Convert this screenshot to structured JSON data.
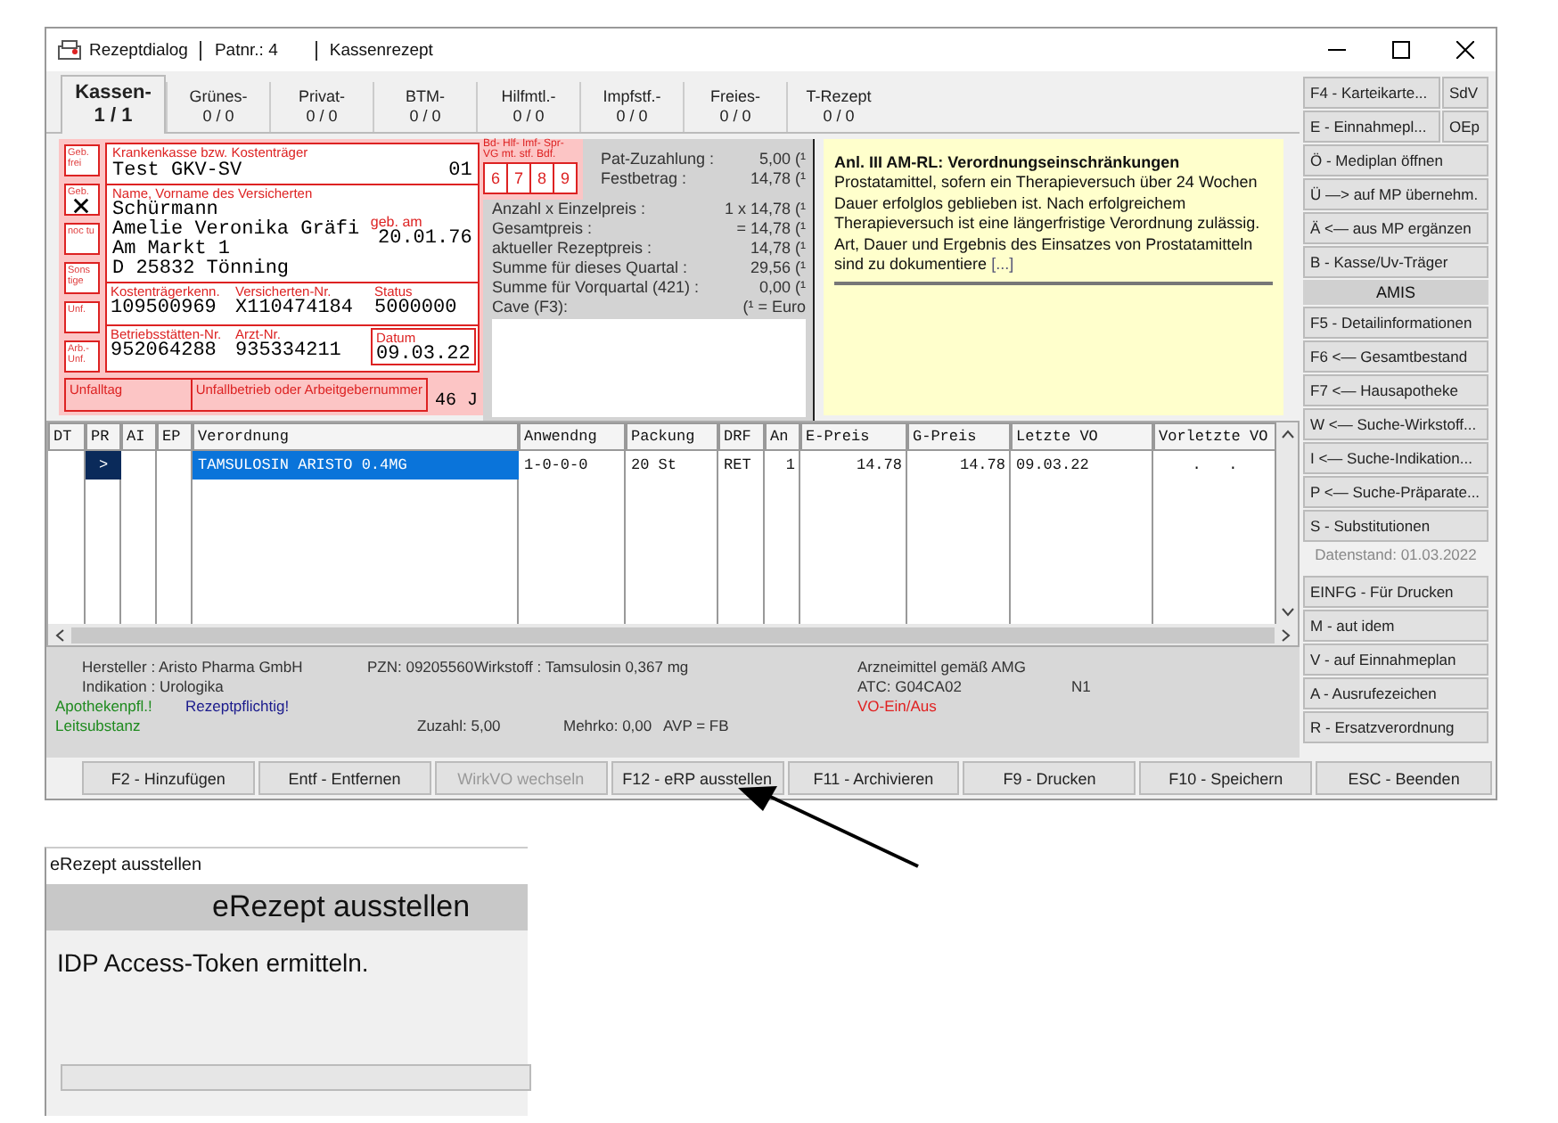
{
  "window": {
    "title_parts": [
      "Rezeptdialog",
      "Patnr.: 4",
      "Kassenrezept"
    ]
  },
  "tabs": [
    {
      "label": "Kassen-",
      "count": "1 / 1",
      "selected": true
    },
    {
      "label": "Grünes-",
      "count": "0 / 0",
      "selected": false
    },
    {
      "label": "Privat-",
      "count": "0 / 0",
      "selected": false
    },
    {
      "label": "BTM-",
      "count": "0 / 0",
      "selected": false
    },
    {
      "label": "Hilfmtl.-",
      "count": "0 / 0",
      "selected": false
    },
    {
      "label": "Impfstf.-",
      "count": "0 / 0",
      "selected": false
    },
    {
      "label": "Freies-",
      "count": "0 / 0",
      "selected": false
    },
    {
      "label": "T-Rezept",
      "count": "0 / 0",
      "selected": false
    }
  ],
  "form": {
    "side_boxes": [
      {
        "label": "Geb. frei",
        "checked": false
      },
      {
        "label": "Geb.",
        "checked": true
      },
      {
        "label": "noc tu",
        "checked": false
      },
      {
        "label": "Sons tige",
        "checked": false
      },
      {
        "label": "Unf.",
        "checked": false
      },
      {
        "label": "Arb.- Unf.",
        "checked": false
      }
    ],
    "insurer_label": "Krankenkasse bzw. Kostenträger",
    "insurer": "Test GKV-SV",
    "insurer_code": "01",
    "name_label": "Name, Vorname des Versicherten",
    "name_lines": [
      "Schürmann",
      "Amelie Veronika Gräfi",
      "Am Markt 1",
      "D 25832 Tönning"
    ],
    "birth_label": "geb. am",
    "birth": "20.01.76",
    "id_rows": [
      [
        {
          "label": "Kostenträgerkenn.",
          "value": "109500969"
        },
        {
          "label": "Versicherten-Nr.",
          "value": "X110474184"
        },
        {
          "label": "Status",
          "value": "5000000"
        }
      ],
      [
        {
          "label": "Betriebsstätten-Nr.",
          "value": "952064288"
        },
        {
          "label": "Arzt-Nr.",
          "value": "935334211"
        },
        {
          "label": "Datum",
          "value": "09.03.22"
        }
      ]
    ],
    "accident_date_label": "Unfalltag",
    "accident_company_label": "Unfallbetrieb oder Arbeitgebernummer",
    "age": "46 J"
  },
  "extra_boxes": {
    "header_lines": [
      "Bd- Hlf- Imf- Spr-",
      "VG mt. stf. Bdf."
    ],
    "numbers": [
      "6",
      "7",
      "8",
      "9"
    ]
  },
  "costs": [
    {
      "label": "Pat-Zuzahlung :",
      "value": "5,00 (¹"
    },
    {
      "label": "Festbetrag :",
      "value": "14,78 (¹"
    },
    {
      "label": "Anzahl x Einzelpreis :",
      "value": "1 x  14,78 (¹"
    },
    {
      "label": "Gesamtpreis :",
      "value": "=  14,78 (¹"
    },
    {
      "label": "aktueller Rezeptpreis :",
      "value": "14,78 (¹"
    },
    {
      "label": "Summe für dieses Quartal :",
      "value": "29,56 (¹"
    },
    {
      "label": "Summe für Vorquartal (421) :",
      "value": "0,00 (¹"
    },
    {
      "label": "Cave (F3):",
      "value": "(¹ = Euro"
    }
  ],
  "note": {
    "title": "Anl. III AM-RL: Verordnungseinschränkungen",
    "body": "Prostatamittel, sofern ein Therapieversuch über 24 Wochen Dauer erfolglos geblieben ist. Nach erfolgreichem Therapieversuch ist eine längerfristige Verordnung zulässig. Art, Dauer und Ergebnis des Einsatzes von Prostatamitteln sind zu dokumentiere",
    "more": "[...]"
  },
  "side_buttons": [
    {
      "kind": "pair",
      "labels": [
        "F4 - Karteikarte...",
        "SdV"
      ]
    },
    {
      "kind": "pair",
      "labels": [
        "E - Einnahmepl...",
        "OEp"
      ]
    },
    {
      "kind": "button",
      "labels": [
        "Ö - Mediplan öffnen"
      ]
    },
    {
      "kind": "button",
      "labels": [
        "Ü —> auf MP übernehm."
      ]
    },
    {
      "kind": "button",
      "labels": [
        "Ä <— aus MP ergänzen"
      ]
    },
    {
      "kind": "button",
      "labels": [
        "B - Kasse/Uv-Träger"
      ]
    },
    {
      "kind": "header",
      "labels": [
        "AMIS"
      ]
    },
    {
      "kind": "button",
      "labels": [
        "F5 - Detailinformationen"
      ]
    },
    {
      "kind": "button",
      "labels": [
        "F6 <— Gesamtbestand"
      ]
    },
    {
      "kind": "button",
      "labels": [
        "F7 <— Hausapotheke"
      ]
    },
    {
      "kind": "button",
      "labels": [
        "W <— Suche-Wirkstoff..."
      ]
    },
    {
      "kind": "button",
      "labels": [
        "I  <— Suche-Indikation..."
      ]
    },
    {
      "kind": "button",
      "labels": [
        "P <— Suche-Präparate..."
      ]
    },
    {
      "kind": "button",
      "labels": [
        "S - Substitutionen"
      ]
    },
    {
      "kind": "note",
      "labels": [
        "Datenstand: 01.03.2022"
      ]
    },
    {
      "kind": "button",
      "labels": [
        "EINFG - Für Drucken"
      ]
    },
    {
      "kind": "button",
      "labels": [
        "M - aut idem"
      ]
    },
    {
      "kind": "button",
      "labels": [
        "V - auf Einnahmeplan"
      ]
    },
    {
      "kind": "button",
      "labels": [
        "A - Ausrufezeichen"
      ]
    },
    {
      "kind": "button",
      "labels": [
        "R - Ersatzverordnung"
      ]
    }
  ],
  "table": {
    "columns": [
      "DT",
      "PR",
      "AI",
      "EP",
      "Verordnung",
      "Anwendng",
      "Packung",
      "DRF",
      "An",
      "E-Preis",
      "G-Preis",
      "Letzte VO",
      "Vorletzte VO"
    ],
    "rows": [
      {
        "cells": [
          {
            "text": "",
            "selected": false
          },
          {
            "text": ">",
            "selected": true
          },
          {
            "text": "",
            "selected": false
          },
          {
            "text": "",
            "selected": false
          },
          {
            "text": "TAMSULOSIN ARISTO 0.4MG",
            "selected": true
          },
          {
            "text": "1-0-0-0",
            "selected": false
          },
          {
            "text": "20 St",
            "selected": false
          },
          {
            "text": "RET",
            "selected": false
          },
          {
            "text": "1",
            "selected": false
          },
          {
            "text": "14.78",
            "selected": false
          },
          {
            "text": "14.78",
            "selected": false
          },
          {
            "text": "09.03.22",
            "selected": false
          },
          {
            "text": ".   .",
            "selected": false
          }
        ]
      }
    ]
  },
  "info_rows": [
    [
      {
        "text": "Hersteller : Aristo Pharma GmbH"
      },
      {
        "text": "PZN: 09205560"
      },
      {
        "text": "Wirkstoff : Tamsulosin 0,367 mg"
      },
      {
        "text": "Arzneimittel gemäß AMG"
      }
    ],
    [
      {
        "text": "Indikation : Urologika"
      },
      {
        "text": "ATC: G04CA02"
      },
      {
        "text": "N1"
      }
    ],
    [
      {
        "text": "Apothekenpfl.!",
        "color": "#1e8a1e"
      },
      {
        "text": "Rezeptpflichtig!",
        "color": "#1a1a8c"
      },
      {
        "text": "VO-Ein/Aus",
        "color": "#e02020"
      }
    ],
    [
      {
        "text": "Leitsubstanz",
        "color": "#1e8a1e"
      },
      {
        "text": "Zuzahl: 5,00"
      },
      {
        "text": "Mehrko: 0,00"
      },
      {
        "text": "AVP = FB"
      }
    ]
  ],
  "bottom_buttons": [
    {
      "label": "F2 - Hinzufügen",
      "disabled": false
    },
    {
      "label": "Entf - Entfernen",
      "disabled": false
    },
    {
      "label": "WirkVO wechseln",
      "disabled": true
    },
    {
      "label": "F12 - eRP ausstellen",
      "disabled": false
    },
    {
      "label": "F11 - Archivieren",
      "disabled": false
    },
    {
      "label": "F9 - Drucken",
      "disabled": false
    },
    {
      "label": "F10 - Speichern",
      "disabled": false
    },
    {
      "label": "ESC - Beenden",
      "disabled": false
    }
  ],
  "popup": {
    "title": "eRezept ausstellen",
    "heading": "eRezept ausstellen",
    "message": "IDP Access-Token ermitteln.",
    "progress": {
      "level": 0
    }
  }
}
